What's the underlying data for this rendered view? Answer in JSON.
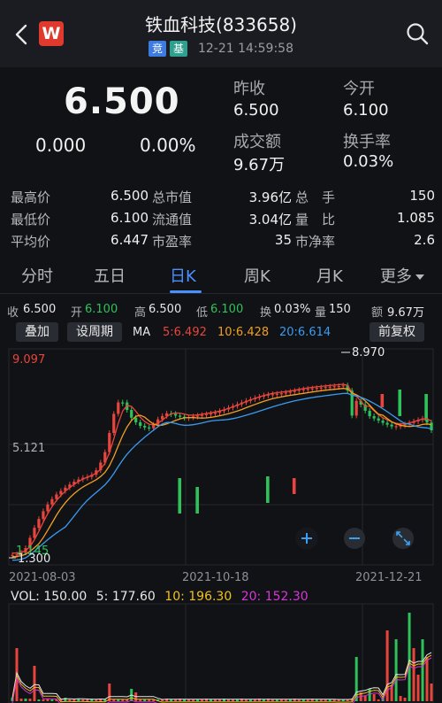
{
  "header": {
    "title": "铁血科技(833658)",
    "badge1": "竞",
    "badge2": "基",
    "datetime": "12-21 14:59:58",
    "logo_letter": "W"
  },
  "quote": {
    "price": "6.500",
    "change": "0.000",
    "change_pct": "0.00%",
    "prev_close_label": "昨收",
    "prev_close": "6.500",
    "open_label": "今开",
    "open": "6.100",
    "amount_label": "成交额",
    "amount": "9.67万",
    "turnover_label": "换手率",
    "turnover": "0.03%"
  },
  "stats": {
    "row1": [
      "最高价",
      "6.500",
      "总市值",
      "3.96亿",
      "总　手",
      "150"
    ],
    "row2": [
      "最低价",
      "6.100",
      "流通值",
      "3.04亿",
      "量　比",
      "1.085"
    ],
    "row3": [
      "平均价",
      "6.447",
      "市盈率",
      "35",
      "市净率",
      "2.6"
    ]
  },
  "tabs": [
    "分时",
    "五日",
    "日K",
    "周K",
    "月K",
    "更多"
  ],
  "active_tab": "日K",
  "info_bar": {
    "close_label": "收",
    "close": "6.500",
    "open_label": "开",
    "open": "6.100",
    "high_label": "高",
    "high": "6.500",
    "low_label": "低",
    "low": "6.100",
    "turn_label": "换",
    "turn": "0.03%",
    "vol_label": "量",
    "vol": "150",
    "amt_label": "额",
    "amt": "9.67万"
  },
  "controls": {
    "overlay": "叠加",
    "set_period": "设周期",
    "ma_label": "MA",
    "ma5": "5:6.492",
    "ma10": "10:6.428",
    "ma20": "20:6.614",
    "adjust": "前复权"
  },
  "kline": {
    "y_top": "9.097",
    "y_mid": "5.121",
    "y_low_label": "1.145",
    "min_marker": "1.300",
    "max_marker": "8.970",
    "dates": [
      "2021-08-03",
      "2021-10-18",
      "2021-12-21"
    ]
  },
  "volume": {
    "vol": "VOL: 150.00",
    "ma5": "5: 177.60",
    "ma10": "10: 196.30",
    "ma20": "20: 152.30"
  },
  "colors": {
    "up": "#e8453c",
    "down": "#2fc25b",
    "ma5": "#e8453c",
    "ma10": "#f0a020",
    "ma20": "#3a9bf0",
    "vol20": "#d438d4",
    "accent": "#4a90ff"
  }
}
